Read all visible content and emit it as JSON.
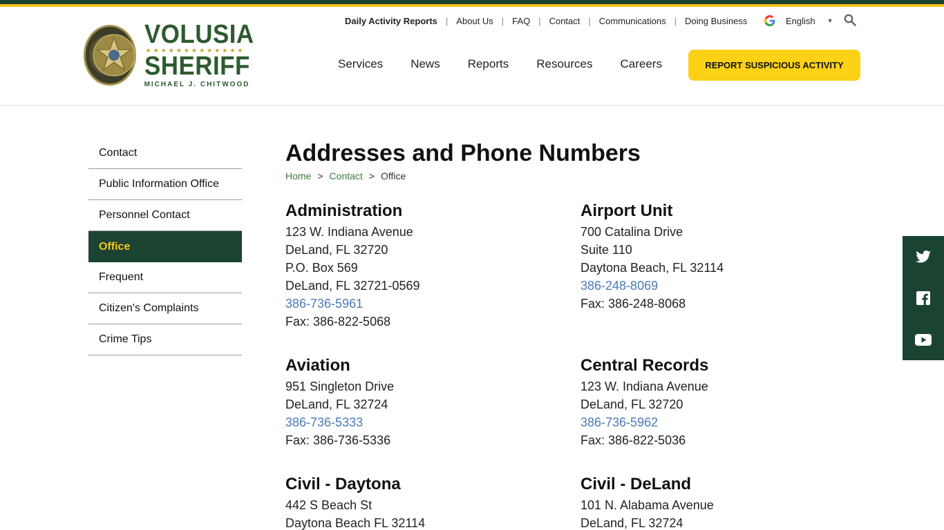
{
  "brand": {
    "line1": "VOLUSIA",
    "line2": "SHERIFF",
    "stars": "★★★★★★★★★★★★★",
    "line3": "MICHAEL J. CHITWOOD"
  },
  "utility_nav": [
    "Daily Activity Reports",
    "About Us",
    "FAQ",
    "Contact",
    "Communications",
    "Doing Business"
  ],
  "language": "English",
  "main_nav": [
    "Services",
    "News",
    "Reports",
    "Resources",
    "Careers"
  ],
  "cta_label": "REPORT SUSPICIOUS ACTIVITY",
  "sidebar": [
    "Contact",
    "Public Information Office",
    "Personnel Contact",
    "Office",
    "Frequent",
    "Citizen's Complaints",
    "Crime Tips"
  ],
  "page_title": "Addresses and Phone Numbers",
  "breadcrumb": {
    "home": "Home",
    "contact": "Contact",
    "current": "Office",
    "sep": ">"
  },
  "offices": [
    {
      "name": "Administration",
      "lines": [
        "123 W. Indiana Avenue",
        "DeLand, FL 32720",
        "P.O. Box 569",
        "DeLand, FL 32721-0569"
      ],
      "phone": "386-736-5961",
      "fax": "Fax: 386-822-5068"
    },
    {
      "name": "Airport Unit",
      "lines": [
        "700 Catalina Drive",
        "Suite 110",
        "Daytona Beach, FL 32114"
      ],
      "phone": "386-248-8069",
      "fax": "Fax: 386-248-8068"
    },
    {
      "name": "Aviation",
      "lines": [
        "951 Singleton Drive",
        "DeLand, FL 32724"
      ],
      "phone": "386-736-5333",
      "fax": "Fax: 386-736-5336"
    },
    {
      "name": "Central Records",
      "lines": [
        "123 W. Indiana Avenue",
        "DeLand, FL 32720"
      ],
      "phone": "386-736-5962",
      "fax": "Fax: 386-822-5036"
    },
    {
      "name": "Civil - Daytona",
      "lines": [
        "442 S Beach St",
        "Daytona Beach FL 32114"
      ],
      "phone": "",
      "fax": ""
    },
    {
      "name": "Civil - DeLand",
      "lines": [
        "101 N. Alabama Avenue",
        "DeLand, FL 32724"
      ],
      "phone": "",
      "fax": ""
    }
  ],
  "colors": {
    "brand_green": "#1b4332",
    "gold": "#fcd116",
    "link_blue": "#4a7ab8"
  },
  "social_icons": [
    "twitter-icon",
    "facebook-icon",
    "youtube-icon"
  ]
}
